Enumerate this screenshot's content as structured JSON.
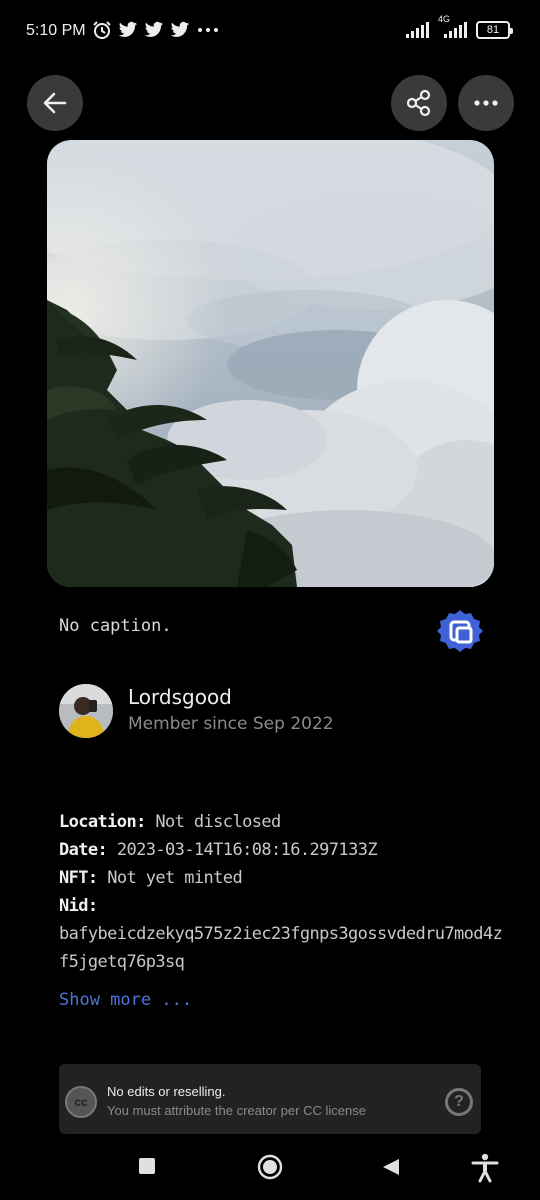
{
  "status_bar": {
    "time": "5:10 PM",
    "left_icons": [
      "alarm-icon",
      "twitter-icon",
      "twitter-icon",
      "twitter-icon",
      "more-dots-icon"
    ],
    "network": "4G",
    "battery": "81"
  },
  "header": {
    "back_icon": "arrow-left-icon",
    "share_icon": "share-icon",
    "more_icon": "more-horizontal-icon"
  },
  "post": {
    "caption": "No caption.",
    "badge_icon": "verified-badge-icon",
    "badge_color": "#3f63d6"
  },
  "author": {
    "name": "Lordsgood",
    "member_since": "Member since Sep 2022"
  },
  "details": {
    "location_label": "Location:",
    "location_value": "Not disclosed",
    "date_label": "Date:",
    "date_value": "2023-03-14T16:08:16.297133Z",
    "nft_label": "NFT:",
    "nft_value": "Not yet minted",
    "nid_label": "Nid:",
    "nid_value": "bafybeicdzekyq575z2iec23fgnps3gossvdedru7mod4zf5jgetq76p3sq"
  },
  "show_more": "Show more ...",
  "license": {
    "icon_text": "cc",
    "title": "No edits or reselling.",
    "subtitle": "You must attribute the creator per CC license",
    "help_icon": "?"
  },
  "nav_bar": {
    "buttons": [
      "recents-icon",
      "home-icon",
      "back-icon",
      "accessibility-icon"
    ]
  },
  "colors": {
    "accent": "#4f74d9",
    "background": "#000000",
    "button_bg": "#3a3a3a"
  }
}
